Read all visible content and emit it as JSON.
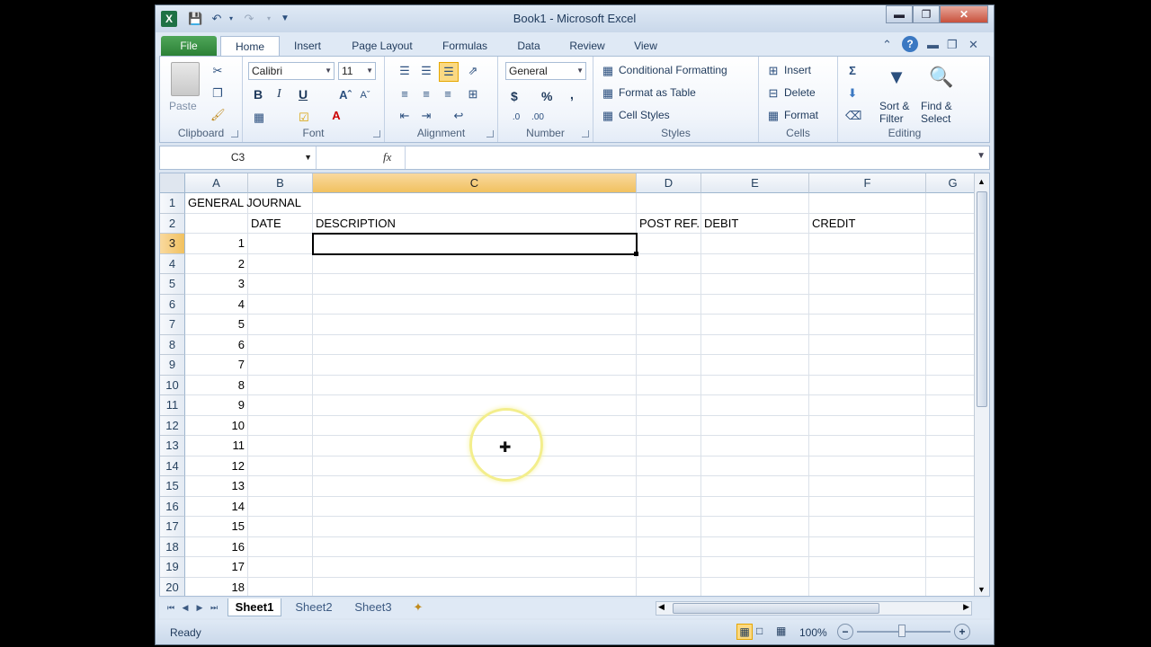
{
  "window": {
    "title": "Book1  -  Microsoft Excel",
    "app_icon": "X"
  },
  "tabs": [
    "File",
    "Home",
    "Insert",
    "Page Layout",
    "Formulas",
    "Data",
    "Review",
    "View"
  ],
  "ribbon": {
    "clipboard": {
      "label": "Clipboard",
      "paste": "Paste"
    },
    "font": {
      "label": "Font",
      "name": "Calibri",
      "size": "11",
      "bold": "B",
      "italic": "I",
      "underline": "U"
    },
    "alignment": {
      "label": "Alignment"
    },
    "number": {
      "label": "Number",
      "format": "General",
      "currency": "$",
      "percent": "%",
      "comma": ","
    },
    "styles": {
      "label": "Styles",
      "conditional": "Conditional Formatting",
      "format_table": "Format as Table",
      "cell_styles": "Cell Styles"
    },
    "cells": {
      "label": "Cells",
      "insert": "Insert",
      "delete": "Delete",
      "format": "Format"
    },
    "editing": {
      "label": "Editing",
      "sort": "Sort &",
      "filter": "Filter",
      "find": "Find &",
      "select": "Select"
    }
  },
  "formula_bar": {
    "name_box": "C3",
    "fx": "fx",
    "value": ""
  },
  "columns": [
    "A",
    "B",
    "C",
    "D",
    "E",
    "F",
    "G"
  ],
  "selected_column": "C",
  "selected_row": "3",
  "rows": [
    "1",
    "2",
    "3",
    "4",
    "5",
    "6",
    "7",
    "8",
    "9",
    "10",
    "11",
    "12",
    "13",
    "14",
    "15",
    "16",
    "17",
    "18",
    "19",
    "20"
  ],
  "cells": {
    "A1": "GENERAL JOURNAL",
    "B2": "DATE",
    "C2": "DESCRIPTION",
    "D2": "POST REF.",
    "E2": "DEBIT",
    "F2": "CREDIT",
    "entry_numbers": [
      "1",
      "2",
      "3",
      "4",
      "5",
      "6",
      "7",
      "8",
      "9",
      "10",
      "11",
      "12",
      "13",
      "14",
      "15",
      "16",
      "17",
      "18"
    ]
  },
  "sheets": [
    "Sheet1",
    "Sheet2",
    "Sheet3"
  ],
  "active_sheet": "Sheet1",
  "status": {
    "mode": "Ready",
    "zoom": "100%"
  }
}
